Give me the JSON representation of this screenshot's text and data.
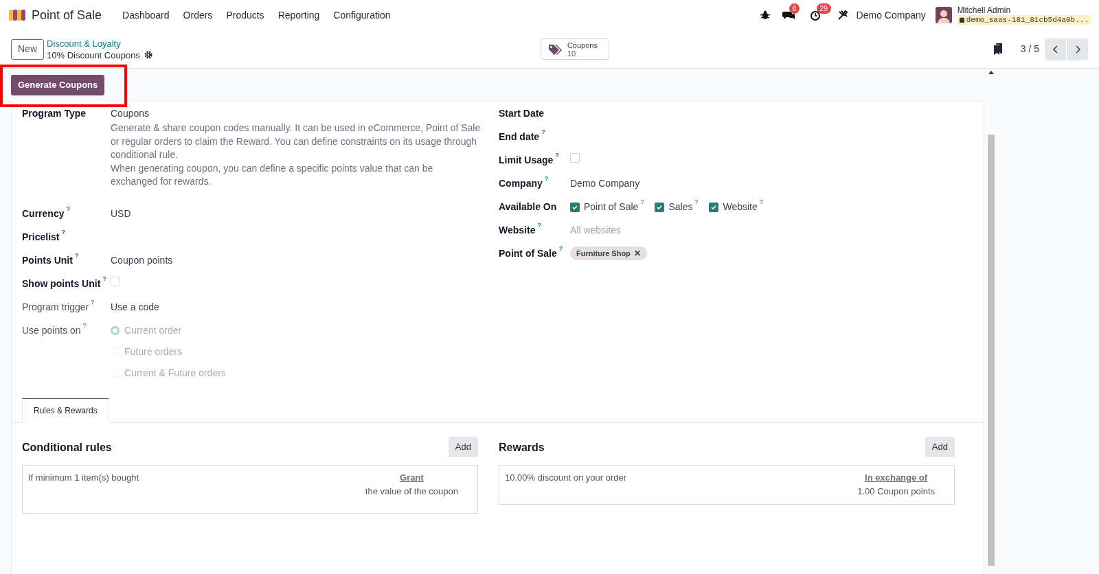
{
  "navbar": {
    "app_name": "Point of Sale",
    "menu": [
      "Dashboard",
      "Orders",
      "Products",
      "Reporting",
      "Configuration"
    ],
    "messages_badge": "8",
    "activities_badge": "29",
    "company": "Demo Company",
    "user_name": "Mitchell Admin",
    "database": "demo_saas-181_81cb5d4a0b..."
  },
  "control_panel": {
    "new_button": "New",
    "breadcrumb": "Discount & Loyalty",
    "record_title": "10% Discount Coupons",
    "smart_button": {
      "label": "Coupons",
      "count": "10"
    },
    "pager": "3 / 5"
  },
  "status_bar": {
    "buttons": [
      "Generate Coupons"
    ]
  },
  "form": {
    "left_fields": [
      {
        "kind": "text",
        "label": "Program Type",
        "value": "Coupons",
        "bold": true
      },
      {
        "kind": "description",
        "paragraphs": [
          "Generate & share coupon codes manually. It can be used in eCommerce, Point of Sale or regular orders to claim the Reward. You can define constraints on its usage through conditional rule.",
          "When generating coupon, you can define a specific points value that can be exchanged for rewards."
        ]
      },
      {
        "kind": "text",
        "label": "Currency",
        "tooltip": "?",
        "value": "USD",
        "bold": true
      },
      {
        "kind": "text",
        "label": "Pricelist",
        "tooltip": "?",
        "bold": true
      },
      {
        "kind": "text",
        "label": "Points Unit",
        "tooltip": "?",
        "value": "Coupon points",
        "bold": true
      },
      {
        "kind": "checkbox",
        "label": "Show points Unit",
        "tooltip": "?",
        "checked": false,
        "bold": true
      },
      {
        "kind": "text",
        "label": "Program trigger",
        "tooltip": "?",
        "value": "Use a code",
        "bold": false
      },
      {
        "kind": "radio",
        "label": "Use points on",
        "tooltip": "?",
        "bold": false,
        "disabled": true,
        "options": [
          {
            "label": "Current order",
            "selected": true
          },
          {
            "label": "Future orders",
            "selected": false
          },
          {
            "label": "Current & Future orders",
            "selected": false
          }
        ]
      }
    ],
    "right_fields": [
      {
        "kind": "text",
        "label": "Start Date",
        "bold": true
      },
      {
        "kind": "text",
        "label": "End date",
        "tooltip": "?",
        "bold": true
      },
      {
        "kind": "checkbox",
        "label": "Limit Usage",
        "tooltip": "?",
        "checked": false,
        "bold": true
      },
      {
        "kind": "text",
        "label": "Company",
        "tooltip": "?",
        "value": "Demo Company",
        "bold": true
      },
      {
        "kind": "checkboxes",
        "label": "Available On",
        "bold": true,
        "options": [
          {
            "label": "Point of Sale",
            "tooltip": "?",
            "checked": true
          },
          {
            "label": "Sales",
            "tooltip": "?",
            "checked": true
          },
          {
            "label": "Website",
            "tooltip": "?",
            "checked": true
          }
        ]
      },
      {
        "kind": "placeholder",
        "label": "Website",
        "tooltip": "?",
        "placeholder": "All websites",
        "bold": true
      },
      {
        "kind": "tags",
        "label": "Point of Sale",
        "tooltip": "?",
        "bold": true,
        "tags": [
          "Furniture Shop"
        ],
        "remove_mark": "✕"
      }
    ]
  },
  "tabs": [
    {
      "label": "Rules & Rewards",
      "selected": true
    }
  ],
  "sections": [
    {
      "title": "Conditional rules",
      "add_button": "Add",
      "row": {
        "text": "If minimum 1 item(s) bought",
        "link": "Grant",
        "detail": "the value of the coupon"
      }
    },
    {
      "title": "Rewards",
      "add_button": "Add",
      "row": {
        "text": "10.00% discount on your order",
        "link": "In exchange of",
        "detail": "1.00 Coupon points"
      }
    }
  ]
}
